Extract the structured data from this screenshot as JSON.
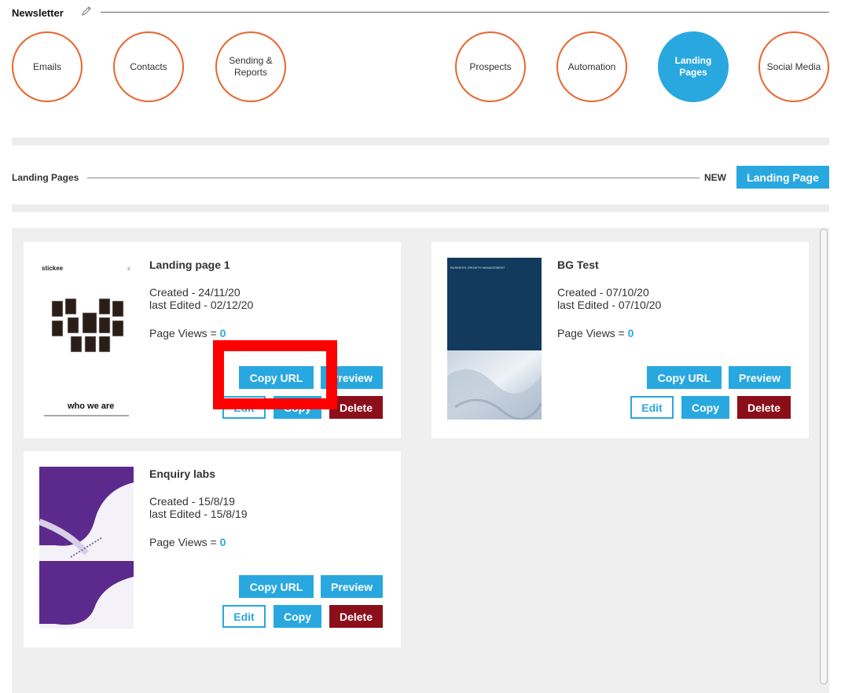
{
  "header": {
    "title": "Newsletter",
    "edit_icon": "pencil-icon"
  },
  "nav": [
    {
      "label": "Emails",
      "active": false
    },
    {
      "label": "Contacts",
      "active": false
    },
    {
      "label": "Sending &\nReports",
      "active": false
    },
    {
      "label": "Prospects",
      "active": false
    },
    {
      "label": "Automation",
      "active": false
    },
    {
      "label": "Landing\nPages",
      "active": true
    },
    {
      "label": "Social Media",
      "active": false
    }
  ],
  "section": {
    "label": "Landing Pages",
    "new_text": "NEW",
    "new_button": "Landing Page"
  },
  "cards": [
    {
      "name": "Landing page 1",
      "created": "Created - 24/11/20",
      "edited": "last Edited - 02/12/20",
      "views_label": "Page Views = ",
      "views": "0",
      "thumb_text_top": "stickee",
      "thumb_text_bottom": "who we are"
    },
    {
      "name": "BG Test",
      "created": "Created - 07/10/20",
      "edited": "last Edited - 07/10/20",
      "views_label": "Page Views = ",
      "views": "0",
      "thumb_text_top": "BUSINESS\nGROWTH\nMANAGEMENT"
    },
    {
      "name": "Enquiry labs",
      "created": "Created - 15/8/19",
      "edited": "last Edited - 15/8/19",
      "views_label": "Page Views = ",
      "views": "0"
    }
  ],
  "buttons": {
    "copy_url": "Copy URL",
    "preview": "Preview",
    "edit": "Edit",
    "copy": "Copy",
    "delete": "Delete"
  },
  "colors": {
    "accent": "#29a8e0",
    "nav_border": "#e8662f",
    "delete": "#8b0f1a",
    "highlight": "#ff0000"
  }
}
